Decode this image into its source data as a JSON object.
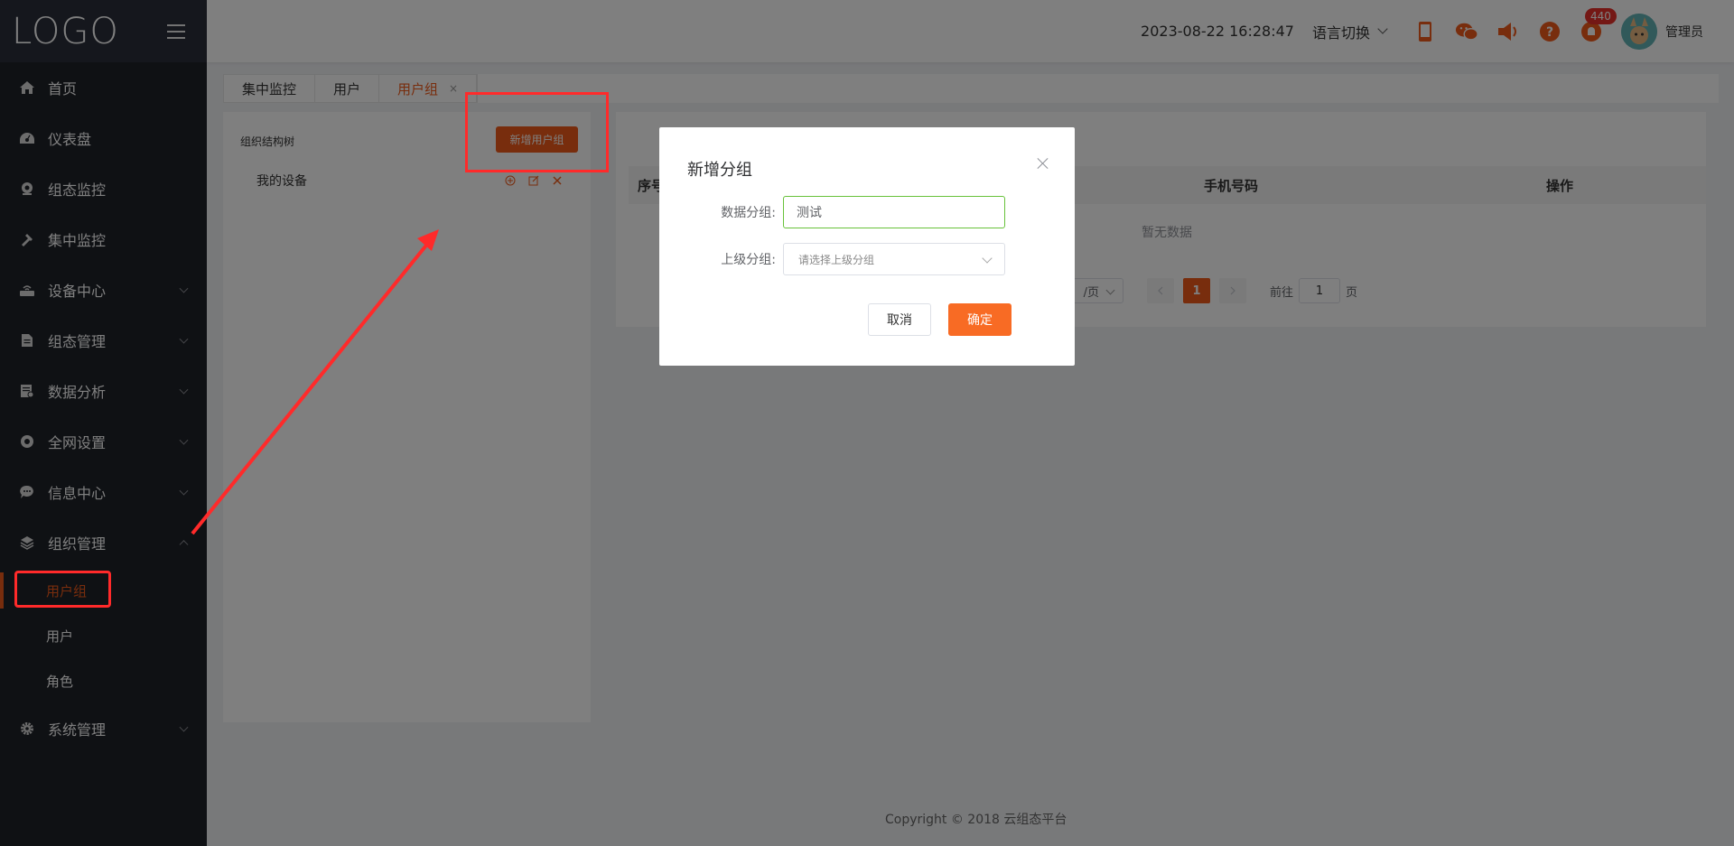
{
  "app": {
    "logo": "LOGO"
  },
  "sidebar": {
    "items": [
      {
        "label": "首页",
        "icon": "home-icon"
      },
      {
        "label": "仪表盘",
        "icon": "dashboard-icon"
      },
      {
        "label": "组态监控",
        "icon": "monitor-icon"
      },
      {
        "label": "集中监控",
        "icon": "hammer-icon"
      },
      {
        "label": "设备中心",
        "icon": "router-icon"
      },
      {
        "label": "组态管理",
        "icon": "document-icon"
      },
      {
        "label": "数据分析",
        "icon": "analysis-icon"
      },
      {
        "label": "全网设置",
        "icon": "settings-ring-icon"
      },
      {
        "label": "信息中心",
        "icon": "chat-bubble-icon"
      },
      {
        "label": "组织管理",
        "icon": "layers-icon"
      }
    ],
    "org_sub": [
      {
        "label": "用户组"
      },
      {
        "label": "用户"
      },
      {
        "label": "角色"
      }
    ],
    "system": {
      "label": "系统管理",
      "icon": "gear-icon"
    }
  },
  "header": {
    "datetime": "2023-08-22 16:28:47",
    "language": "语言切换",
    "badge_count": "440",
    "username": "管理员"
  },
  "tabs": [
    {
      "label": "集中监控"
    },
    {
      "label": "用户"
    },
    {
      "label": "用户组",
      "active": true
    }
  ],
  "tree_panel": {
    "title": "组织结构树",
    "add_button": "新增用户组",
    "node": "我的设备"
  },
  "table": {
    "columns": [
      "序号",
      "手机号码",
      "操作"
    ],
    "empty_text": "暂无数据",
    "page_size_suffix": "/页",
    "current_page": "1",
    "goto_prefix": "前往",
    "goto_value": "1",
    "goto_suffix": "页"
  },
  "footer": {
    "copyright": "Copyright © 2018 云组态平台"
  },
  "modal": {
    "title": "新增分组",
    "field_group_label": "数据分组:",
    "field_group_value": "测试",
    "field_parent_label": "上级分组:",
    "field_parent_placeholder": "请选择上级分组",
    "cancel": "取消",
    "confirm": "确定"
  },
  "colors": {
    "accent": "#f05a1a",
    "sidebar_bg": "#1f2229",
    "annotation_red": "#ff2a2a"
  }
}
